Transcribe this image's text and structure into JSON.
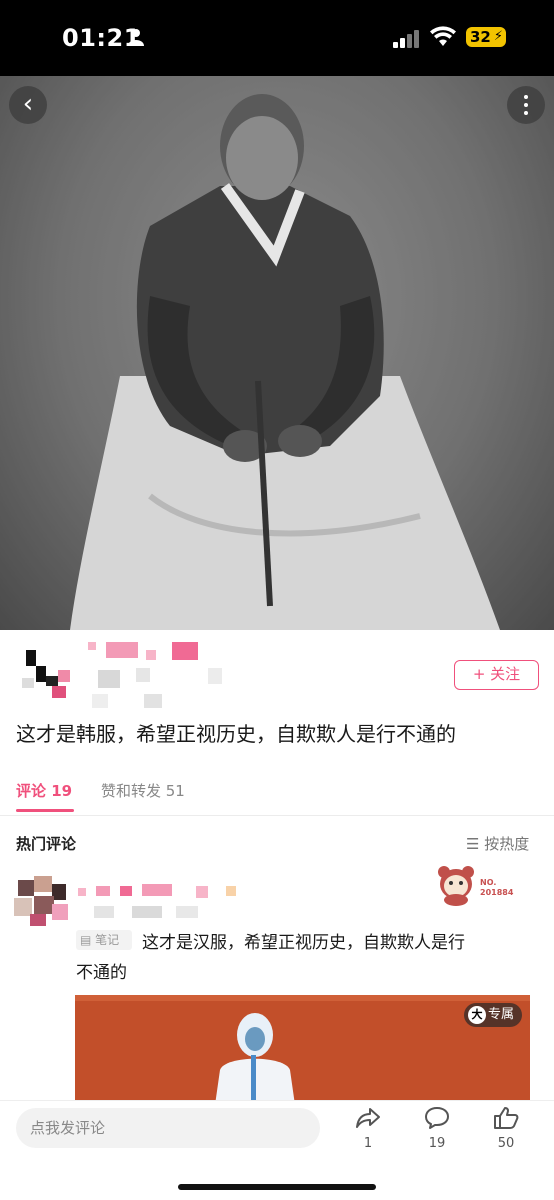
{
  "status_bar": {
    "time": "01:21",
    "battery": "32"
  },
  "post": {
    "text": "这才是韩服，希望正视历史，自欺欺人是行不通的",
    "follow_label": "+ 关注"
  },
  "tabs": [
    {
      "label": "评论 19"
    },
    {
      "label": "赞和转发 51"
    }
  ],
  "comments_section": {
    "title": "热门评论",
    "sort_label": "☰ 按热度"
  },
  "comment": {
    "badge_no_line1": "NO.",
    "badge_no_line2": "201884",
    "note_tag": "笔记",
    "text_line1": "这才是汉服，希望正视历史，自欺欺人是行",
    "text_line2": "不通的",
    "exclusive_icon": "大",
    "exclusive_label": "专属"
  },
  "bottom_bar": {
    "placeholder": "点我发评论",
    "share_count": "1",
    "comment_count": "19",
    "like_count": "50"
  },
  "colors": {
    "accent": "#f0507c",
    "status_bg": "#000000",
    "image_bg": "#c24f2a"
  },
  "icons": [
    "person-icon",
    "signal-icon",
    "wifi-icon",
    "back-icon",
    "more-icon",
    "share-icon",
    "comment-icon",
    "like-icon",
    "note-icon"
  ]
}
